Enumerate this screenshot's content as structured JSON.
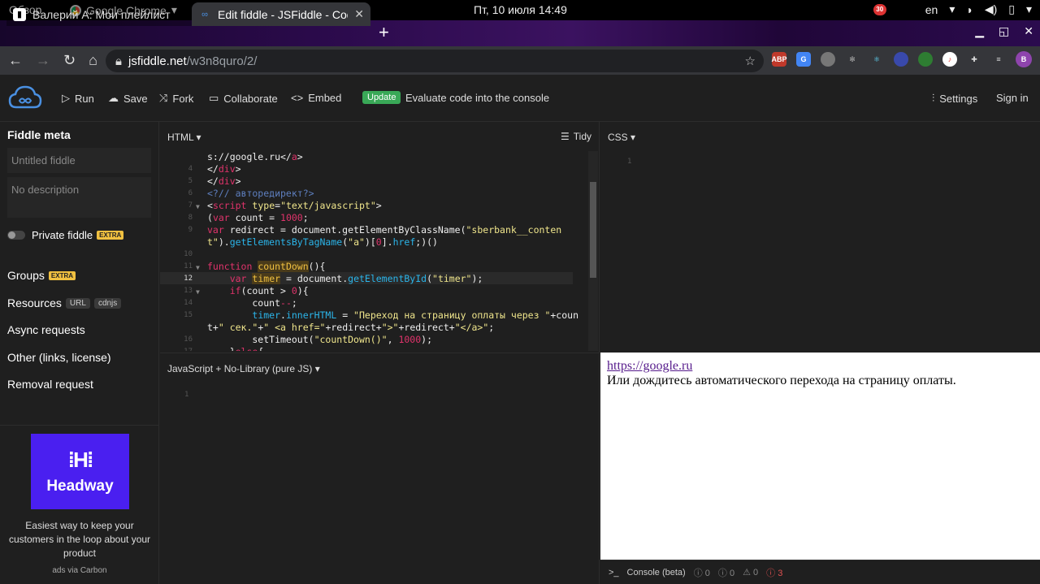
{
  "system": {
    "activities": "Обзор",
    "app_name": "Google Chrome",
    "clock": "Пт, 10 июля  14:49",
    "keyboard_layout": "en",
    "notif_count": "30"
  },
  "browser": {
    "tabs": [
      {
        "title": "Валерий А: Мои плейлист",
        "active": false
      },
      {
        "title": "Edit fiddle - JSFiddle - Code",
        "active": true
      }
    ],
    "url_host": "jsfiddle.net",
    "url_path": "/w3n8quro/2/",
    "profile_letter": "B",
    "extensions": [
      "ABP",
      "G",
      "puzzle",
      "gear",
      "atom",
      "drop",
      "circle",
      "music",
      "pencil"
    ]
  },
  "toolbar": {
    "run": "Run",
    "save": "Save",
    "fork": "Fork",
    "collaborate": "Collaborate",
    "embed": "Embed",
    "update_badge": "Update",
    "eval_note": "Evaluate code into the console",
    "settings": "Settings",
    "sign_in": "Sign in"
  },
  "sidebar": {
    "title": "Fiddle meta",
    "name_placeholder": "Untitled fiddle",
    "desc_placeholder": "No description",
    "private_label": "Private fiddle",
    "extra": "EXTRA",
    "groups": "Groups",
    "resources": "Resources",
    "resources_url": "URL",
    "resources_cdn": "cdnjs",
    "async": "Async requests",
    "other": "Other (links, license)",
    "removal": "Removal request"
  },
  "ad": {
    "brand": "Headway",
    "text": "Easiest way to keep your customers in the loop about your product",
    "via": "ads via Carbon"
  },
  "panes": {
    "html_label": "HTML ▾",
    "tidy": "Tidy",
    "css_label": "CSS ▾",
    "js_label": "JavaScript + No-Library (pure JS) ▾",
    "css_line": "1",
    "js_line": "1"
  },
  "result": {
    "link": "https://google.ru",
    "text": "Или дождитесь автоматического перехода на страницу оплаты."
  },
  "console": {
    "label": "Console (beta)",
    "c1": "0",
    "c2": "0",
    "c3": "0",
    "errors": "3"
  }
}
